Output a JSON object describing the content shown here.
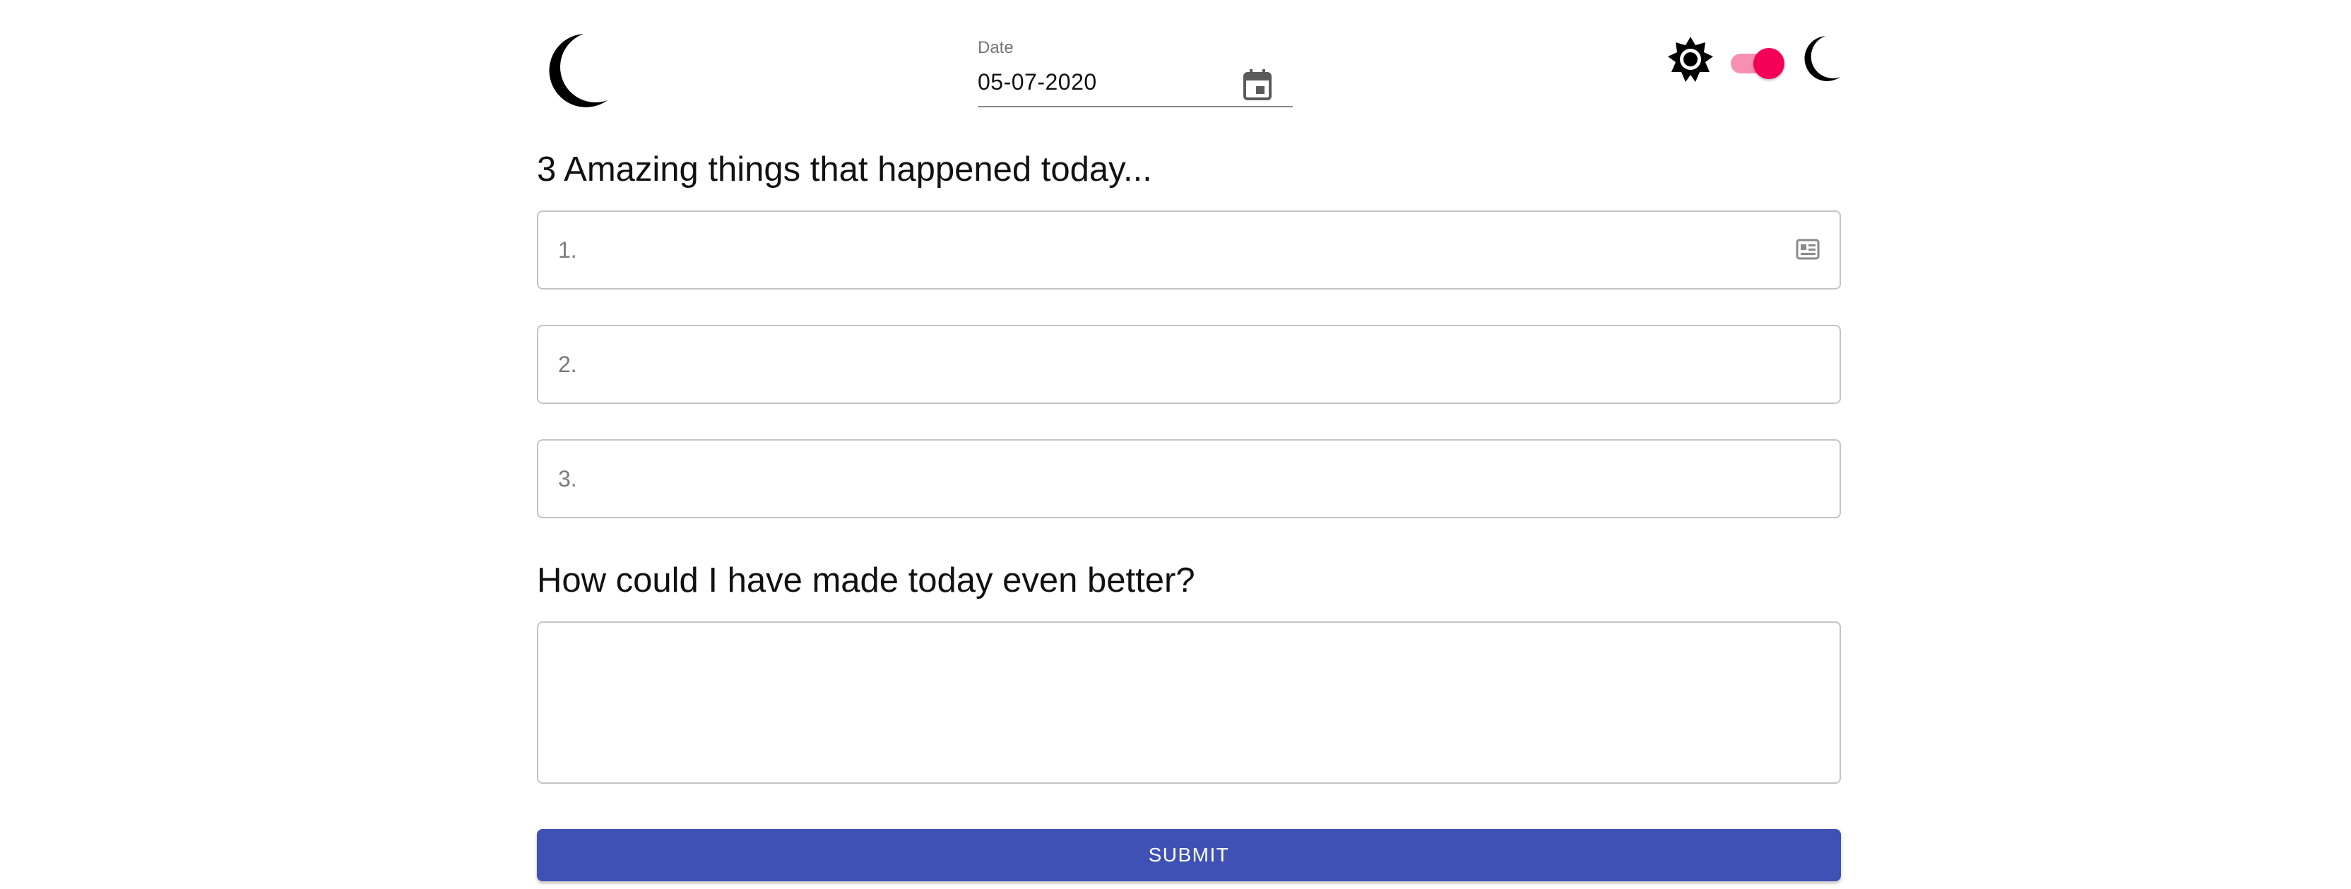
{
  "header": {
    "logo_icon": "moon-icon",
    "date": {
      "label": "Date",
      "value": "05-07-2020",
      "icon": "calendar-icon"
    },
    "theme": {
      "light_icon": "sun-icon",
      "dark_icon": "moon-icon",
      "dark_mode_on": true,
      "toggle_color": "#f50057"
    }
  },
  "gratitude": {
    "title": "3 Amazing things that happened today...",
    "items": [
      {
        "placeholder": "1.",
        "value": ""
      },
      {
        "placeholder": "2.",
        "value": ""
      },
      {
        "placeholder": "3.",
        "value": ""
      }
    ]
  },
  "improvement": {
    "title": "How could I have made today even better?",
    "value": ""
  },
  "submit": {
    "label": "SUBMIT",
    "color": "#3f51b5"
  }
}
